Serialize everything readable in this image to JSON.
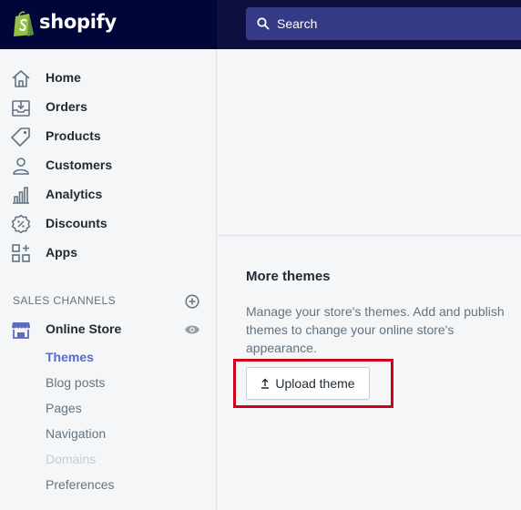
{
  "brand": {
    "name": "shopify"
  },
  "search": {
    "placeholder": "Search"
  },
  "nav": {
    "items": [
      {
        "label": "Home",
        "icon": "home-icon"
      },
      {
        "label": "Orders",
        "icon": "orders-icon"
      },
      {
        "label": "Products",
        "icon": "tag-icon"
      },
      {
        "label": "Customers",
        "icon": "person-icon"
      },
      {
        "label": "Analytics",
        "icon": "bar-chart-icon"
      },
      {
        "label": "Discounts",
        "icon": "discount-icon"
      },
      {
        "label": "Apps",
        "icon": "apps-icon"
      }
    ]
  },
  "sales_channels": {
    "title": "SALES CHANNELS",
    "channel": {
      "label": "Online Store",
      "icon": "store-icon"
    },
    "sub_items": [
      {
        "label": "Themes",
        "state": "active"
      },
      {
        "label": "Blog posts",
        "state": "normal"
      },
      {
        "label": "Pages",
        "state": "normal"
      },
      {
        "label": "Navigation",
        "state": "normal"
      },
      {
        "label": "Domains",
        "state": "disabled"
      },
      {
        "label": "Preferences",
        "state": "normal"
      }
    ]
  },
  "main": {
    "section_title": "More themes",
    "description": "Manage your store's themes. Add and publish themes to change your online store's appearance.",
    "upload_button": "Upload theme"
  },
  "colors": {
    "topbar": "#0e0f3f",
    "brand_bg": "#000639",
    "search_bg": "#353a86",
    "accent": "#5c6ac4",
    "highlight": "#d0021b",
    "logo_green": "#95bf47"
  }
}
